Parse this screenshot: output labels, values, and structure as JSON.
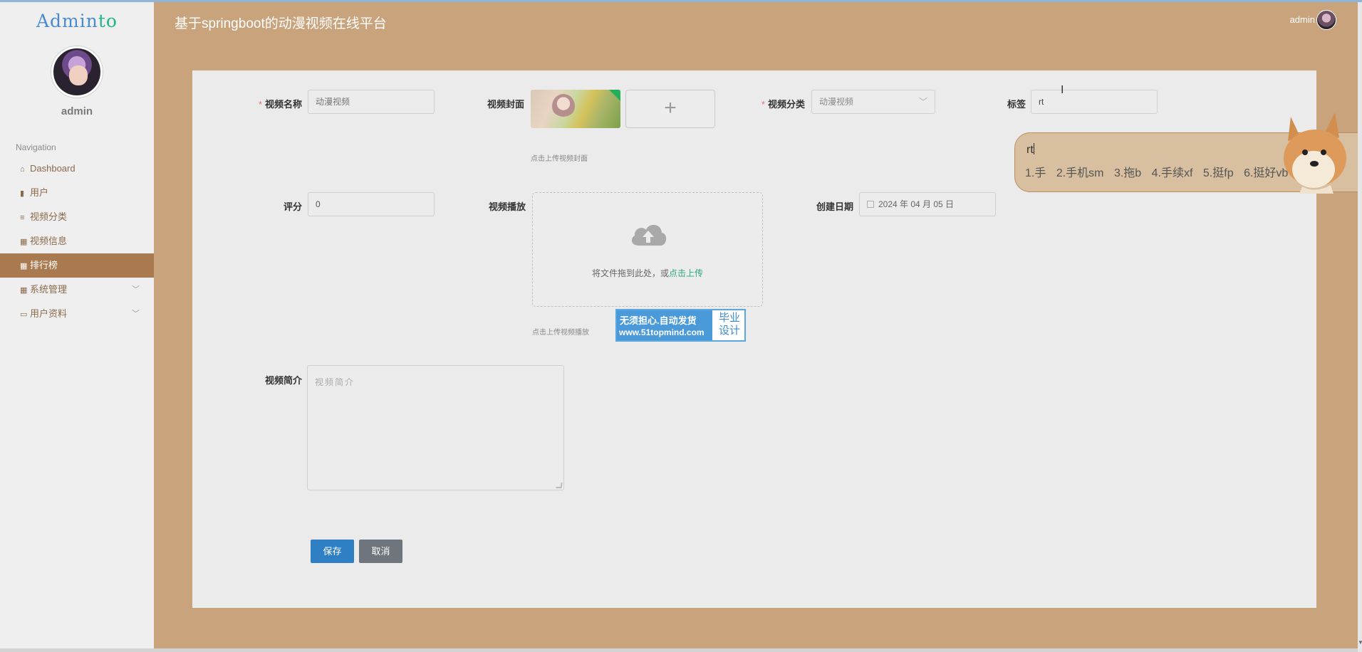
{
  "app": {
    "title": "基于springboot的动漫视频在线平台",
    "user": "admin"
  },
  "sidebar": {
    "logo_text": "Admin",
    "logo_accent": "to",
    "username": "admin",
    "nav_title": "Navigation",
    "items": [
      {
        "label": "Dashboard",
        "icon": "home-icon"
      },
      {
        "label": "用户",
        "icon": "bar-chart-icon"
      },
      {
        "label": "视频分类",
        "icon": "list-icon"
      },
      {
        "label": "视频信息",
        "icon": "grid-icon"
      },
      {
        "label": "排行榜",
        "icon": "table-icon",
        "active": true
      },
      {
        "label": "系统管理",
        "icon": "grid-icon",
        "expandable": true
      },
      {
        "label": "用户资料",
        "icon": "card-icon",
        "expandable": true
      }
    ]
  },
  "form": {
    "video_name": {
      "label": "视频名称",
      "placeholder": "动漫视频"
    },
    "cover": {
      "label": "视频封面",
      "hint": "点击上传视频封面"
    },
    "category": {
      "label": "视频分类",
      "value": "动漫视频"
    },
    "tags": {
      "label": "标签",
      "value": "rt"
    },
    "rating": {
      "label": "评分",
      "value": "0"
    },
    "video_play": {
      "label": "视频播放",
      "drop_text": "将文件拖到此处，或",
      "drop_link": "点击上传",
      "hint": "点击上传视频播放"
    },
    "created_date": {
      "label": "创建日期",
      "value": "2024 年 04 月 05 日"
    },
    "intro": {
      "label": "视频简介",
      "placeholder": "视频简介"
    },
    "save_label": "保存",
    "cancel_label": "取消"
  },
  "ad": {
    "line1": "无须担心.自动发货",
    "line2": "www.51topmind.com",
    "right1": "毕业",
    "right2": "设计"
  },
  "ime": {
    "input": "rt",
    "candidates": [
      "1.手",
      "2.手机sm",
      "3.拖b",
      "4.手续xf",
      "5.挺fp",
      "6.挺好vb"
    ],
    "next_icon": "chevron-right-icon"
  },
  "colors": {
    "background": "#c9a37c",
    "sidebar_active": "#a97a4f",
    "save_button": "#2f7fc5",
    "cancel_button": "#6e757c",
    "link_green": "#2aa87a",
    "required_star": "#f56c6c"
  }
}
